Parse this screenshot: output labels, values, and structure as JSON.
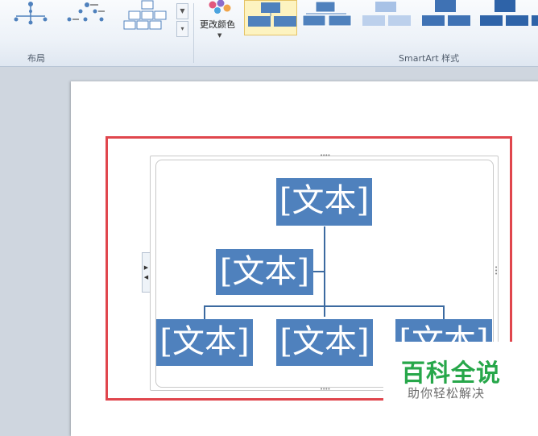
{
  "ribbon": {
    "layout_group_label": "布局",
    "change_color_label": "更改颜色",
    "smartart_styles_label": "SmartArt 样式",
    "layout_thumbnails": [
      "hierarchy-layout-1",
      "hierarchy-layout-2",
      "hierarchy-layout-3"
    ],
    "style_thumbnails": [
      "style-simple-fill",
      "style-white-outline",
      "style-subtle",
      "style-moderate",
      "style-intense"
    ],
    "selected_style_index": 0
  },
  "smartart": {
    "nodes": {
      "top": "[文本]",
      "assistant": "[文本]",
      "child1": "[文本]",
      "child2": "[文本]",
      "child3": "[文本]"
    }
  },
  "watermark": {
    "title": "百科全说",
    "subtitle": "助你轻松解决"
  },
  "colors": {
    "node_fill": "#4f81bd",
    "highlight_border": "#e0464d",
    "watermark_green": "#27a74a"
  }
}
